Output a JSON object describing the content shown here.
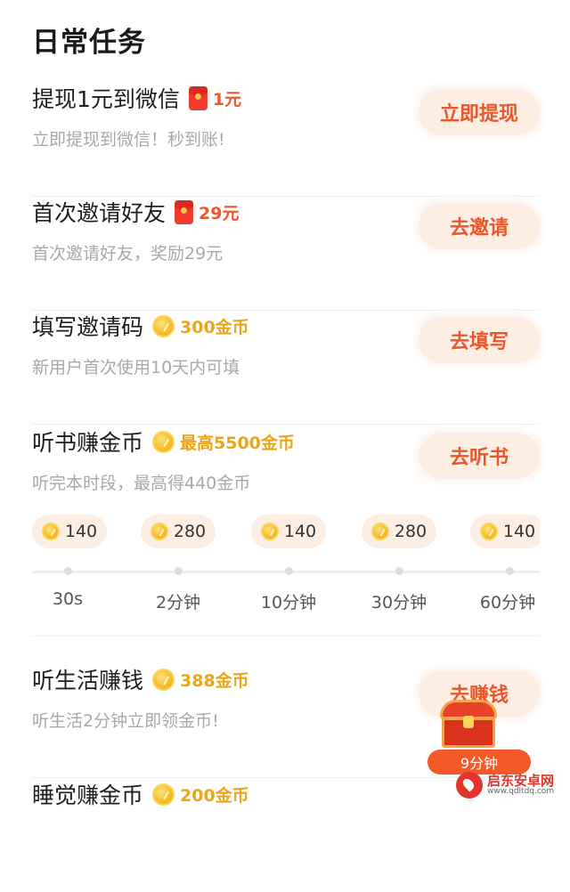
{
  "section_title": "日常任务",
  "tasks": [
    {
      "title": "提现1元到微信",
      "reward": "1元",
      "desc": "立即提现到微信！秒到账!",
      "button": "立即提现"
    },
    {
      "title": "首次邀请好友",
      "reward": "29元",
      "desc": "首次邀请好友，奖励29元",
      "button": "去邀请"
    },
    {
      "title": "填写邀请码",
      "reward": "300金币",
      "desc": "新用户首次使用10天内可填",
      "button": "去填写"
    },
    {
      "title": "听书赚金币",
      "reward": "最高5500金币",
      "desc": "听完本时段，最高得440金币",
      "button": "去听书"
    },
    {
      "title": "听生活赚钱",
      "reward": "388金币",
      "desc": "听生活2分钟立即领金币!",
      "button": "去赚钱"
    },
    {
      "title": "睡觉赚金币",
      "reward": "200金币",
      "desc": "",
      "button": ""
    }
  ],
  "listen_timeline": [
    {
      "coins": "140",
      "time": "30s"
    },
    {
      "coins": "280",
      "time": "2分钟"
    },
    {
      "coins": "140",
      "time": "10分钟"
    },
    {
      "coins": "280",
      "time": "30分钟"
    },
    {
      "coins": "140",
      "time": "60分钟"
    }
  ],
  "chest_timer": "9分钟",
  "watermark": {
    "name": "启东安卓网",
    "url": "www.qdltdq.com"
  },
  "colors": {
    "accent_red": "#f0552c",
    "gold": "#eba51b",
    "button_bg": "#fdeee4"
  },
  "icons": {
    "cash_reward": "red-envelope-icon",
    "coin_reward": "gold-coin-icon",
    "chest": "treasure-chest-icon"
  }
}
